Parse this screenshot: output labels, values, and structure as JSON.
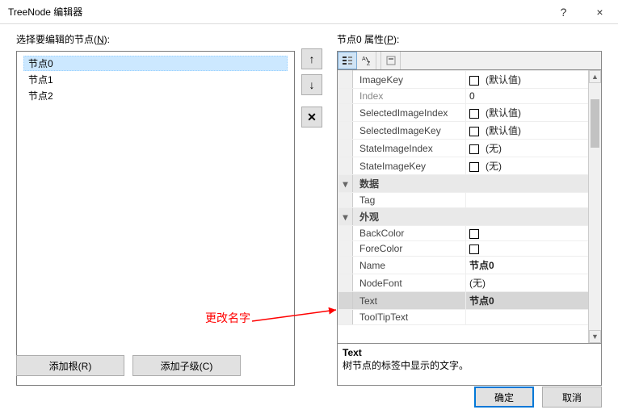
{
  "window": {
    "title": "TreeNode 编辑器",
    "help": "?",
    "close": "×"
  },
  "left": {
    "label_pre": "选择要编辑的节点(",
    "label_key": "N",
    "label_post": "):",
    "nodes": [
      "节点0",
      "节点1",
      "节点2"
    ],
    "selected_index": 0,
    "btn_add_root": "添加根(R)",
    "btn_add_child": "添加子级(C)"
  },
  "buttons": {
    "up": "↑",
    "down": "↓",
    "delete": "✕"
  },
  "right": {
    "label_pre": "节点0 属性(",
    "label_key": "P",
    "label_post": "):",
    "properties": [
      {
        "type": "row",
        "name": "ImageKey",
        "value": "(默认值)",
        "swatch": true
      },
      {
        "type": "row",
        "name": "Index",
        "value": "0",
        "disabled": true
      },
      {
        "type": "row",
        "name": "SelectedImageIndex",
        "value": "(默认值)",
        "swatch": true
      },
      {
        "type": "row",
        "name": "SelectedImageKey",
        "value": "(默认值)",
        "swatch": true
      },
      {
        "type": "row",
        "name": "StateImageIndex",
        "value": "(无)",
        "swatch": true
      },
      {
        "type": "row",
        "name": "StateImageKey",
        "value": "(无)",
        "swatch": true
      },
      {
        "type": "cat",
        "name": "数据"
      },
      {
        "type": "row",
        "name": "Tag",
        "value": ""
      },
      {
        "type": "cat",
        "name": "外观"
      },
      {
        "type": "row",
        "name": "BackColor",
        "value": "",
        "swatch": true
      },
      {
        "type": "row",
        "name": "ForeColor",
        "value": "",
        "swatch": true
      },
      {
        "type": "row",
        "name": "Name",
        "value": "节点0",
        "bold": true
      },
      {
        "type": "row",
        "name": "NodeFont",
        "value": "(无)"
      },
      {
        "type": "row",
        "name": "Text",
        "value": "节点0",
        "bold": true,
        "selected": true
      },
      {
        "type": "row",
        "name": "ToolTipText",
        "value": ""
      }
    ],
    "description": {
      "title": "Text",
      "text": "树节点的标签中显示的文字。"
    }
  },
  "annotation": "更改名字",
  "footer": {
    "ok": "确定",
    "cancel": "取消"
  }
}
